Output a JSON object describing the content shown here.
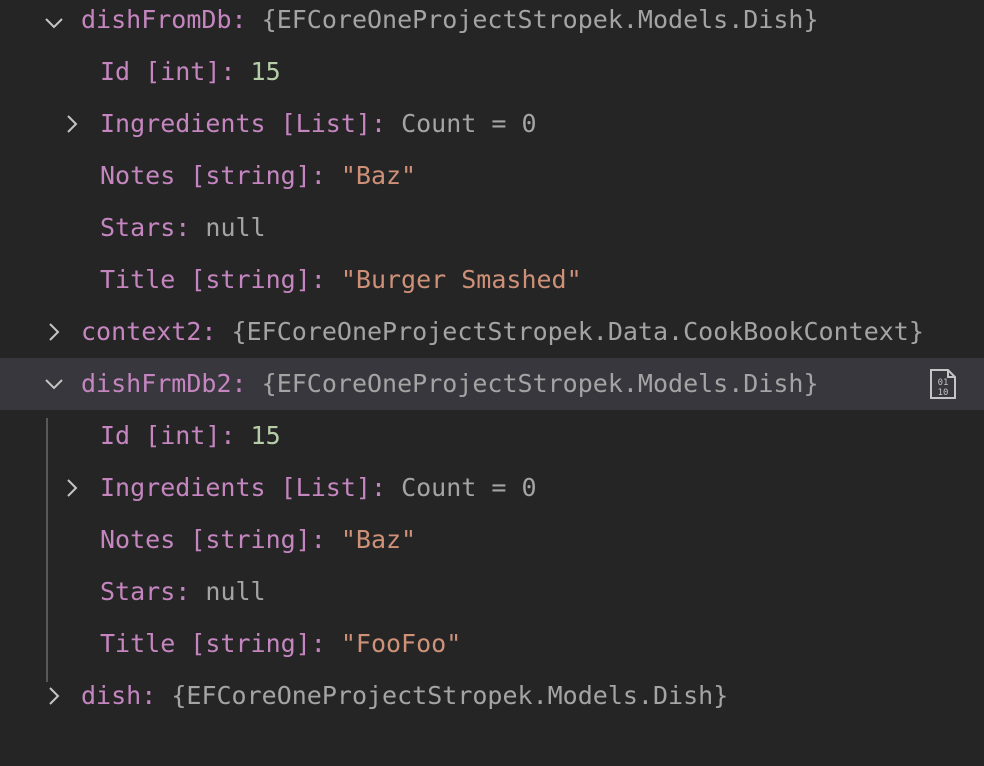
{
  "variables": [
    {
      "name": "dishFromDb",
      "sep": ":",
      "value": "{EFCoreOneProjectStropek.Models.Dish}",
      "expanded": true,
      "children": [
        {
          "name": "Id [int]",
          "sep": ":",
          "value": "15",
          "kind": "number",
          "expandable": false
        },
        {
          "name": "Ingredients [List]",
          "sep": ":",
          "value": "Count = 0",
          "kind": "plain",
          "expandable": true
        },
        {
          "name": "Notes [string]",
          "sep": ":",
          "value": "\"Baz\"",
          "kind": "string",
          "expandable": false
        },
        {
          "name": "Stars",
          "sep": ":",
          "value": "null",
          "kind": "null",
          "expandable": false
        },
        {
          "name": "Title [string]",
          "sep": ":",
          "value": "\"Burger Smashed\"",
          "kind": "string",
          "expandable": false
        }
      ]
    },
    {
      "name": "context2",
      "sep": ":",
      "value": "{EFCoreOneProjectStropek.Data.CookBookContext}",
      "expanded": false
    },
    {
      "name": "dishFrmDb2",
      "sep": ":",
      "value": "{EFCoreOneProjectStropek.Models.Dish}",
      "expanded": true,
      "selected": true,
      "action_icon": "binary-data-icon",
      "children": [
        {
          "name": "Id [int]",
          "sep": ":",
          "value": "15",
          "kind": "number",
          "expandable": false
        },
        {
          "name": "Ingredients [List]",
          "sep": ":",
          "value": "Count = 0",
          "kind": "plain",
          "expandable": true
        },
        {
          "name": "Notes [string]",
          "sep": ":",
          "value": "\"Baz\"",
          "kind": "string",
          "expandable": false
        },
        {
          "name": "Stars",
          "sep": ":",
          "value": "null",
          "kind": "null",
          "expandable": false
        },
        {
          "name": "Title [string]",
          "sep": ":",
          "value": "\"FooFoo\"",
          "kind": "string",
          "expandable": false
        }
      ]
    },
    {
      "name": "dish",
      "sep": ":",
      "value": "{EFCoreOneProjectStropek.Models.Dish}",
      "expanded": false
    }
  ],
  "colors": {
    "background": "#252526",
    "selected_row": "#37373d",
    "name": "#c586c0",
    "type_value": "#a4a4a4",
    "number": "#b5cea8",
    "string": "#ce9178",
    "chevron": "#c5c5c5",
    "indent_guide": "#585858"
  }
}
